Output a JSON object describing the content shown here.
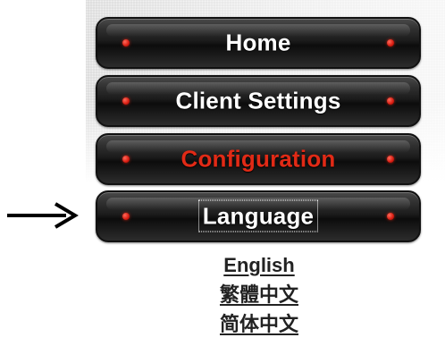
{
  "nav": {
    "items": [
      {
        "label": "Home",
        "state": "normal"
      },
      {
        "label": "Client Settings",
        "state": "normal"
      },
      {
        "label": "Configuration",
        "state": "active"
      },
      {
        "label": "Language",
        "state": "focused"
      }
    ]
  },
  "languages": [
    {
      "label": "English"
    },
    {
      "label": "繁體中文"
    },
    {
      "label": "简体中文"
    }
  ],
  "colors": {
    "button_bg": "#1c1c1c",
    "button_text": "#ffffff",
    "active_text": "#e12a16",
    "indicator_dot": "#d81b10",
    "link_text": "#222222",
    "arrow": "#000000"
  },
  "icons": {
    "pointer": "right-arrow-icon",
    "indicator": "red-dot-icon"
  }
}
